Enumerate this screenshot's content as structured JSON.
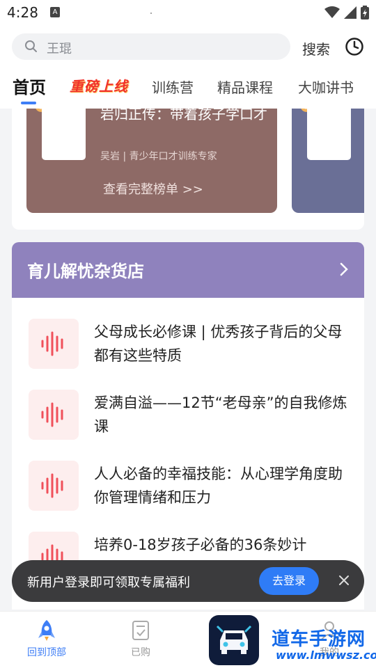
{
  "status_bar": {
    "time": "4:28",
    "notification_letter": "A"
  },
  "search": {
    "placeholder": "王琨",
    "search_label": "搜索"
  },
  "tabs": [
    {
      "label": "首页",
      "active": true
    },
    {
      "label": "重磅上线",
      "highlight": true
    },
    {
      "label": "训练营"
    },
    {
      "label": "精品课程"
    },
    {
      "label": "大咖讲书"
    }
  ],
  "ranking_card": {
    "title": "岩归正传：带着孩子学口才",
    "author": "吴岩 | 青少年口才训练专家",
    "more_label": "查看完整榜单 >>"
  },
  "section": {
    "title": "育儿解忧杂货店",
    "items": [
      {
        "title": "父母成长必修课 | 优秀孩子背后的父母都有这些特质"
      },
      {
        "title": "爱满自溢——12节“老母亲”的自我修炼课"
      },
      {
        "title": "人人必备的幸福技能：从心理学角度助你管理情绪和压力"
      },
      {
        "title": "培养0-18岁孩子必备的36条妙计"
      }
    ]
  },
  "toast": {
    "message": "新用户登录即可领取专属福利",
    "login_label": "去登录"
  },
  "bottom_nav": [
    {
      "label": "回到顶部",
      "active": true
    },
    {
      "label": "已购"
    },
    {
      "label": "我的"
    }
  ],
  "watermark": {
    "title": "道车手游网",
    "url": "www.lmwwsz.com"
  },
  "colors": {
    "accent": "#3e7ef6",
    "section_header": "#8f82bd",
    "ranking_card": "#8e6a66",
    "audio_icon": "#f0505a",
    "toast_bg": "#3b3b3d"
  }
}
